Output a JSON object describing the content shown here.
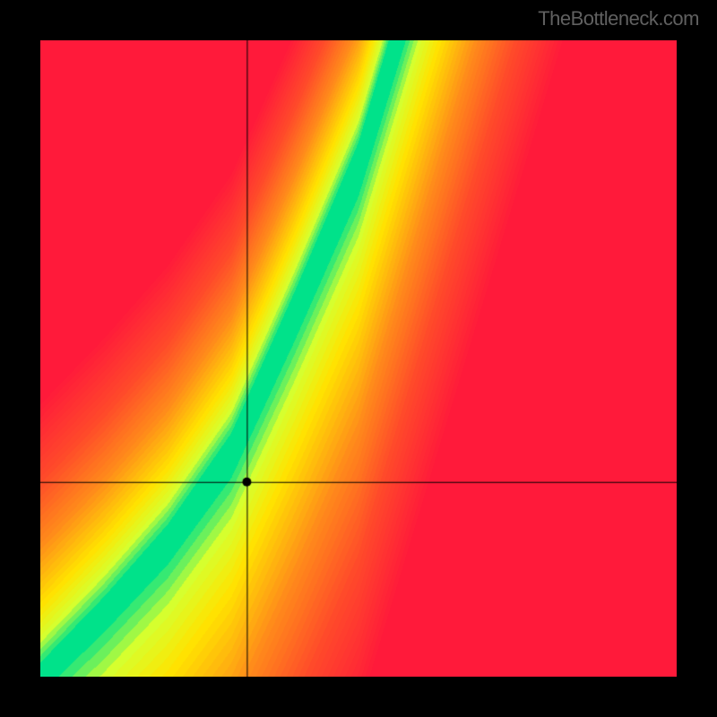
{
  "watermark": "TheBottleneck.com",
  "chart_data": {
    "type": "heatmap",
    "title": "",
    "xlabel": "",
    "ylabel": "",
    "xlim": [
      0,
      1
    ],
    "ylim": [
      0,
      1
    ],
    "crosshair": {
      "x": 0.325,
      "y": 0.305
    },
    "marker": {
      "x": 0.325,
      "y": 0.305,
      "color": "#000000"
    },
    "optimal_curve_description": "Green optimal band along a slightly super-linear diagonal (slope ~1.8) from bottom-left toward top-center; red far from curve (upper-left and lower-right), yellow/orange in between.",
    "optimal_curve_samples": [
      {
        "x": 0.0,
        "y_center": 0.0
      },
      {
        "x": 0.1,
        "y_center": 0.1
      },
      {
        "x": 0.2,
        "y_center": 0.21
      },
      {
        "x": 0.3,
        "y_center": 0.35
      },
      {
        "x": 0.4,
        "y_center": 0.57
      },
      {
        "x": 0.5,
        "y_center": 0.8
      },
      {
        "x": 0.56,
        "y_center": 1.0
      }
    ],
    "color_stops": [
      {
        "t": 0.0,
        "color": "#00e28a"
      },
      {
        "t": 0.1,
        "color": "#d6ff2e"
      },
      {
        "t": 0.22,
        "color": "#ffe400"
      },
      {
        "t": 0.45,
        "color": "#ff8c1a"
      },
      {
        "t": 0.7,
        "color": "#ff4a2a"
      },
      {
        "t": 1.0,
        "color": "#ff1a3a"
      }
    ],
    "grid": false,
    "legend": false
  }
}
